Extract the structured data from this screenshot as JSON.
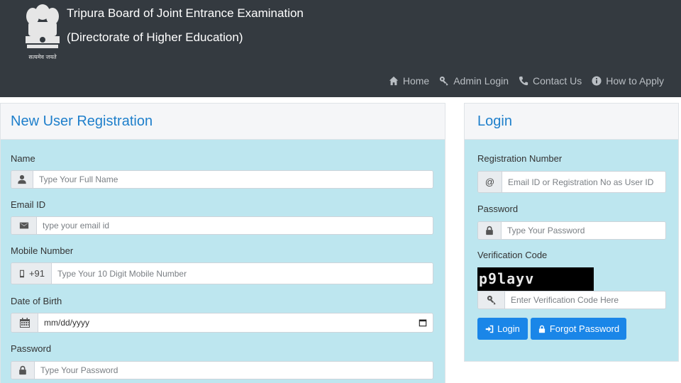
{
  "header": {
    "title": "Tripura Board of Joint Entrance Examination",
    "subtitle": "(Directorate of Higher Education)",
    "emblem_motto": "सत्यमेव जयते",
    "nav": [
      {
        "label": "Home",
        "icon": "home-icon"
      },
      {
        "label": "Admin Login",
        "icon": "key-icon"
      },
      {
        "label": "Contact Us",
        "icon": "phone-icon"
      },
      {
        "label": "How to Apply",
        "icon": "info-icon"
      }
    ]
  },
  "registration": {
    "title": "New User Registration",
    "name": {
      "label": "Name",
      "placeholder": "Type Your Full Name",
      "icon": "user-icon"
    },
    "email": {
      "label": "Email ID",
      "placeholder": "type your email id",
      "icon": "envelope-icon"
    },
    "mobile": {
      "label": "Mobile Number",
      "prefix": "+91",
      "placeholder": "Type Your 10 Digit Mobile Number",
      "icon": "mobile-icon"
    },
    "dob": {
      "label": "Date of Birth",
      "value": "mm/dd/yyyy",
      "icon": "calendar-icon"
    },
    "password": {
      "label": "Password",
      "placeholder": "Type Your Password",
      "icon": "lock-icon"
    }
  },
  "login": {
    "title": "Login",
    "reg_no": {
      "label": "Registration Number",
      "addon": "@",
      "placeholder": "Email ID or Registration No as User ID"
    },
    "password": {
      "label": "Password",
      "placeholder": "Type Your Password",
      "icon": "lock-icon"
    },
    "verification": {
      "label": "Verification Code",
      "captcha": "p9layv",
      "placeholder": "Enter Verification Code Here",
      "icon": "key-icon"
    },
    "login_button": "Login",
    "forgot_button": "Forgot Password"
  },
  "colors": {
    "header_bg": "#343a40",
    "panel_bg": "#bde6ef",
    "accent": "#1a86e8",
    "title": "#1e7fcb"
  }
}
